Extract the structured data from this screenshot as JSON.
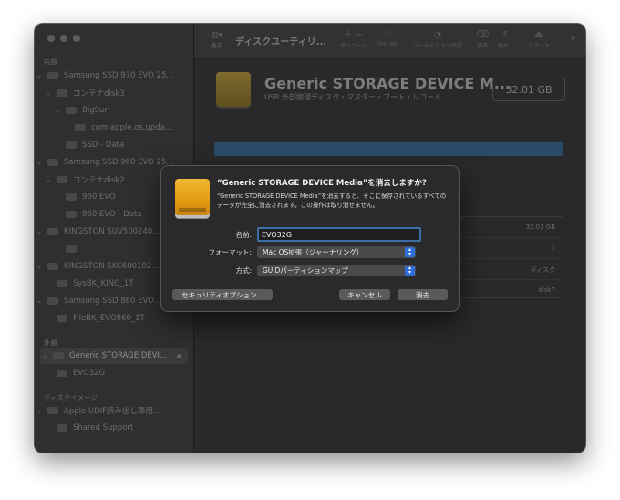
{
  "toolbar": {
    "view_label": "表示",
    "title": "ディスクユーティリ...",
    "buttons": [
      {
        "label": "ボリューム",
        "icon": "plus-minus-icon"
      },
      {
        "label": "First Aid",
        "icon": "stethoscope-icon"
      },
      {
        "label": "パーティション作成",
        "icon": "pie-icon"
      },
      {
        "label": "消去",
        "icon": "erase-icon"
      },
      {
        "label": "復元",
        "icon": "restore-icon"
      },
      {
        "label": "マウント",
        "icon": "mount-icon"
      }
    ]
  },
  "sidebar": {
    "section_internal": "内部",
    "section_external": "外部",
    "section_images": "ディスクイメージ",
    "items": [
      {
        "label": "Samsung SSD 970 EVO 25..."
      },
      {
        "label": "コンテナdisk3"
      },
      {
        "label": "BigSur"
      },
      {
        "label": "com.apple.os.upda..."
      },
      {
        "label": "SSD - Data"
      },
      {
        "label": "Samsung SSD 960 EVO 25..."
      },
      {
        "label": "コンテナdisk2"
      },
      {
        "label": "960 EVO"
      },
      {
        "label": "960 EVO - Data"
      },
      {
        "label": "KINGSTON SUV500240..."
      },
      {
        "label": ""
      },
      {
        "label": "KINGSTON SKC600102..."
      },
      {
        "label": "SysBK_KING_1T"
      },
      {
        "label": "Samsung SSD 860 EVO..."
      },
      {
        "label": "FileBK_EVO860_1T"
      },
      {
        "label": "Generic STORAGE DEVI..."
      },
      {
        "label": "EVO32G"
      },
      {
        "label": "Apple UDIF読み出し専用..."
      },
      {
        "label": "Shared Support"
      }
    ]
  },
  "main": {
    "disk_title": "Generic STORAGE DEVICE M...",
    "disk_subtitle": "USB 外部物理ディスク・マスター・ブート・レコード",
    "size": "32.01 GB",
    "info_values": [
      "32.01 GB",
      "1",
      "ディスク",
      "disk7"
    ]
  },
  "dialog": {
    "title": "“Generic STORAGE DEVICE Media”を消去しますか?",
    "body": "“Generic STORAGE DEVICE Media”を消去すると、そこに保存されているすべてのデータが完全に消去されます。この操作は取り消せません。",
    "name_label": "名前:",
    "name_value": "EVO32G",
    "format_label": "フォーマット:",
    "format_value": "Mac OS拡張（ジャーナリング）",
    "scheme_label": "方式:",
    "scheme_value": "GUIDパーティションマップ",
    "security_button": "セキュリティオプション...",
    "cancel_button": "キャンセル",
    "erase_button": "消去"
  }
}
